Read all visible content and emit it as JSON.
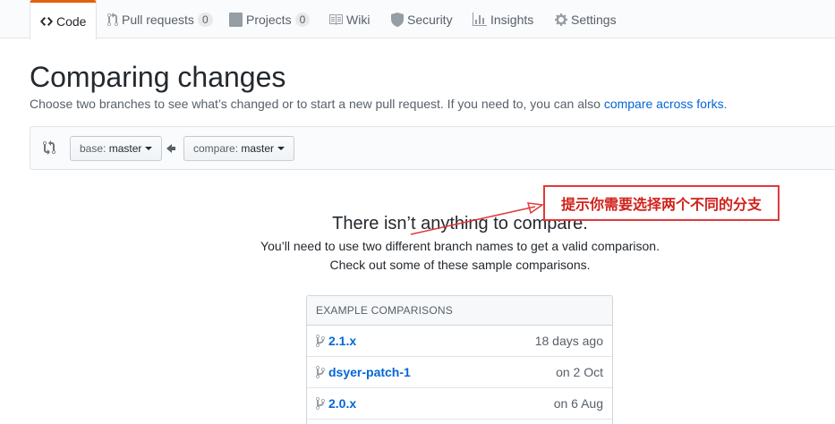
{
  "nav": {
    "tabs": [
      {
        "label": "Code",
        "icon": "code-icon",
        "selected": true
      },
      {
        "label": "Pull requests",
        "icon": "pull-request-icon",
        "count": "0"
      },
      {
        "label": "Projects",
        "icon": "project-icon",
        "count": "0"
      },
      {
        "label": "Wiki",
        "icon": "book-icon"
      },
      {
        "label": "Security",
        "icon": "shield-icon"
      },
      {
        "label": "Insights",
        "icon": "graph-icon"
      },
      {
        "label": "Settings",
        "icon": "gear-icon"
      }
    ]
  },
  "page": {
    "title": "Comparing changes",
    "subtitle": "Choose two branches to see what’s changed or to start a new pull request. If you need to, you can also",
    "subtitle_link": "compare across forks",
    "subtitle_end": "."
  },
  "range": {
    "base_prefix": "base:",
    "base_value": "master",
    "compare_prefix": "compare:",
    "compare_value": "master",
    "icons": [
      "git-compare-icon",
      "arrow-left-icon",
      "triangle-down-icon"
    ]
  },
  "blankslate": {
    "title": "There isn’t anything to compare.",
    "line1": "You’ll need to use two different branch names to get a valid comparison.",
    "line2": "Check out some of these sample comparisons."
  },
  "examples": {
    "header": "EXAMPLE COMPARISONS",
    "rows": [
      {
        "branch": "2.1.x",
        "when": "18 days ago"
      },
      {
        "branch": "dsyer-patch-1",
        "when": "on 2 Oct"
      },
      {
        "branch": "2.0.x",
        "when": "on 6 Aug"
      }
    ]
  },
  "annotation": {
    "text": "提示你需要选择两个不同的分支",
    "color": "#e03a3a"
  },
  "colors": {
    "accent": "#e36209",
    "link": "#0366d6",
    "muted": "#586069"
  }
}
